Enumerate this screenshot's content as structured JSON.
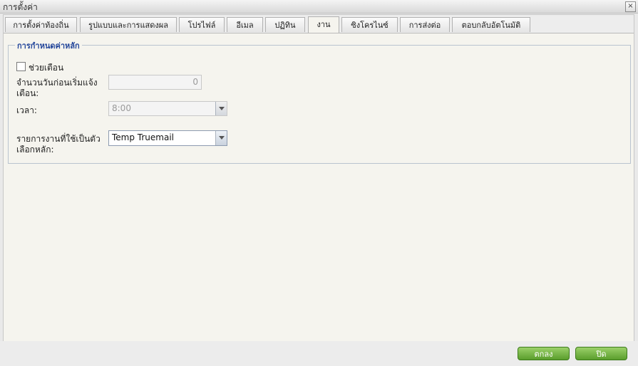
{
  "window": {
    "title": "การตั้งค่า",
    "close_label": "×"
  },
  "tabs": [
    {
      "label": "การตั้งค่าท้องถิ่น"
    },
    {
      "label": "รูปแบบและการแสดงผล"
    },
    {
      "label": "โปรไฟล์"
    },
    {
      "label": "อีเมล"
    },
    {
      "label": "ปฏิทิน"
    },
    {
      "label": "งาน"
    },
    {
      "label": "ซิงโครไนซ์"
    },
    {
      "label": "การส่งต่อ"
    },
    {
      "label": "ตอบกลับอัตโนมัติ"
    }
  ],
  "active_tab": "งาน",
  "section": {
    "legend": "การกำหนดค่าหลัก",
    "reminder": {
      "label": "ช่วยเตือน",
      "checked": false
    },
    "days_before": {
      "label_line1": "จำนวนวันก่อนเริ่มแจ้ง",
      "label_line2": "เตือน:",
      "value": "0"
    },
    "time": {
      "label": "เวลา:",
      "value": "8:00"
    },
    "default_list": {
      "label_line1": "รายการงานที่ใช้เป็นตัว",
      "label_line2": "เลือกหลัก:",
      "value": "Temp Truemail"
    }
  },
  "footer": {
    "ok_label": "ตกลง",
    "close_label": "ปิด"
  },
  "colors": {
    "accent": "#22459a",
    "button_green": "#5a9e2c"
  }
}
